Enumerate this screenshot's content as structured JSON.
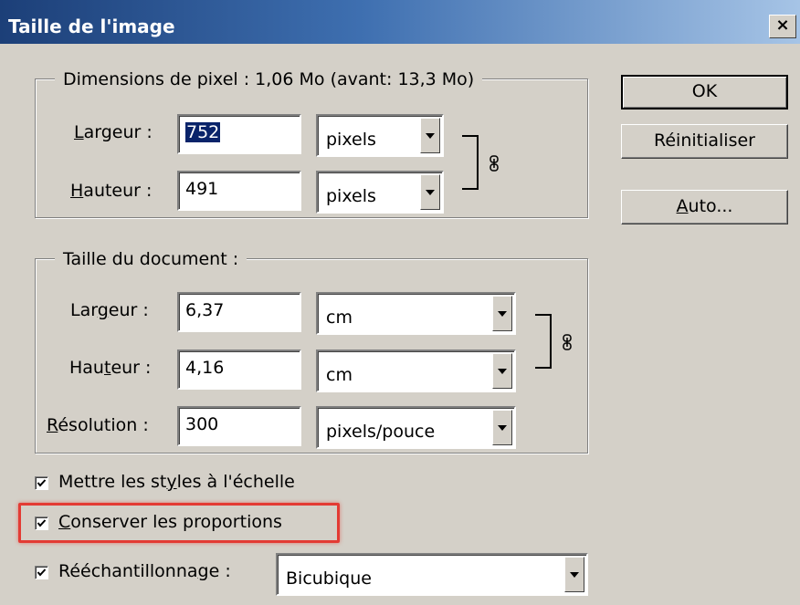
{
  "window": {
    "title": "Taille de l'image",
    "close_symbol": "×"
  },
  "pixel_dimensions": {
    "legend": "Dimensions de pixel : 1,06 Mo (avant: 13,3 Mo)",
    "width_label": {
      "before": "",
      "mnemonic": "L",
      "after": "argeur :"
    },
    "width_value": "752",
    "width_unit": "pixels",
    "height_label": {
      "before": "",
      "mnemonic": "H",
      "after": "auteur :"
    },
    "height_value": "491",
    "height_unit": "pixels"
  },
  "document_size": {
    "legend": "Taille du document :",
    "width_label": {
      "before": "Lar",
      "mnemonic": "g",
      "after": "eur :"
    },
    "width_value": "6,37",
    "width_unit": "cm",
    "height_label": {
      "before": "Hau",
      "mnemonic": "t",
      "after": "eur :"
    },
    "height_value": "4,16",
    "height_unit": "cm",
    "resolution_label": {
      "before": "",
      "mnemonic": "R",
      "after": "ésolution :"
    },
    "resolution_value": "300",
    "resolution_unit": "pixels/pouce"
  },
  "buttons": {
    "ok": "OK",
    "reset": "Réinitialiser",
    "auto": {
      "before": "",
      "mnemonic": "A",
      "after": "uto..."
    }
  },
  "options": {
    "scale_styles": {
      "before": "Mettre les st",
      "mnemonic": "y",
      "after": "les à l'échelle",
      "checked": true
    },
    "constrain": {
      "before": "",
      "mnemonic": "C",
      "after": "onserver les proportions",
      "checked": true
    },
    "resample": {
      "before": "Rééchantillonna",
      "mnemonic": "g",
      "after": "e :",
      "checked": true
    },
    "resample_method": "Bicubique"
  },
  "colors": {
    "highlight": "#e33b34",
    "titlebar": "#1c3f78",
    "dialog": "#d4d0c8"
  },
  "icons": {
    "link": "chain-link-icon",
    "dropdown": "chevron-down-icon",
    "check": "checkmark-icon"
  }
}
